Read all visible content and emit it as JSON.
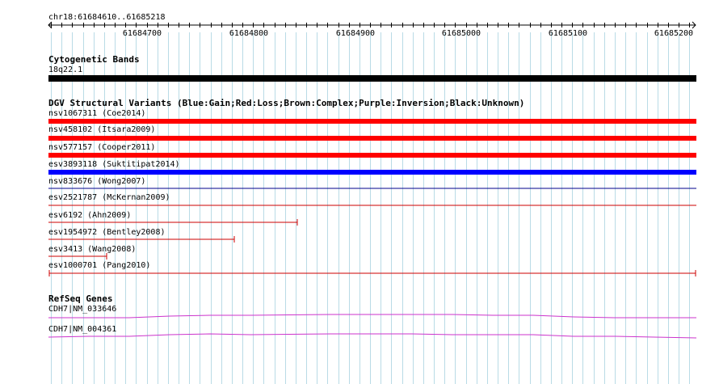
{
  "ruler": {
    "location": "chr18:61684610..61685218",
    "ticks": [
      "61684700",
      "61684800",
      "61684900",
      "61685000",
      "61685100",
      "61685200"
    ]
  },
  "cytoband": {
    "title": "Cytogenetic Bands",
    "band": "18q22.1",
    "color": "#000000"
  },
  "dgv": {
    "title": "DGV Structural Variants (Blue:Gain;Red:Loss;Brown:Complex;Purple:Inversion;Black:Unknown)",
    "variants": [
      {
        "label": "nsv1067311 (Coe2014)",
        "color": "#ff0000",
        "thick": true
      },
      {
        "label": "nsv458102 (Itsara2009)",
        "color": "#ff0000",
        "thick": true
      },
      {
        "label": "nsv577157 (Cooper2011)",
        "color": "#ff0000",
        "thick": true
      },
      {
        "label": "esv3893118 (Suktitipat2014)",
        "color": "#0000ff",
        "thick": true
      },
      {
        "label": "nsv833676 (Wong2007)",
        "color": "#00008b",
        "thick": false
      },
      {
        "label": "esv2521787 (McKernan2009)",
        "color": "#cc0000",
        "thick": false
      },
      {
        "label": "esv6192 (Ahn2009)",
        "color": "#cc0000",
        "thick": false
      },
      {
        "label": "esv1954972 (Bentley2008)",
        "color": "#cc0000",
        "thick": false
      },
      {
        "label": "esv3413 (Wang2008)",
        "color": "#cc0000",
        "thick": false
      },
      {
        "label": "esv1000701 (Pang2010)",
        "color": "#cc0000",
        "thick": false
      }
    ]
  },
  "refseq": {
    "title": "RefSeq Genes",
    "genes": [
      {
        "label": "CDH7|NM_033646",
        "color": "#cc33cc"
      },
      {
        "label": "CDH7|NM_004361",
        "color": "#cc33cc"
      }
    ]
  }
}
